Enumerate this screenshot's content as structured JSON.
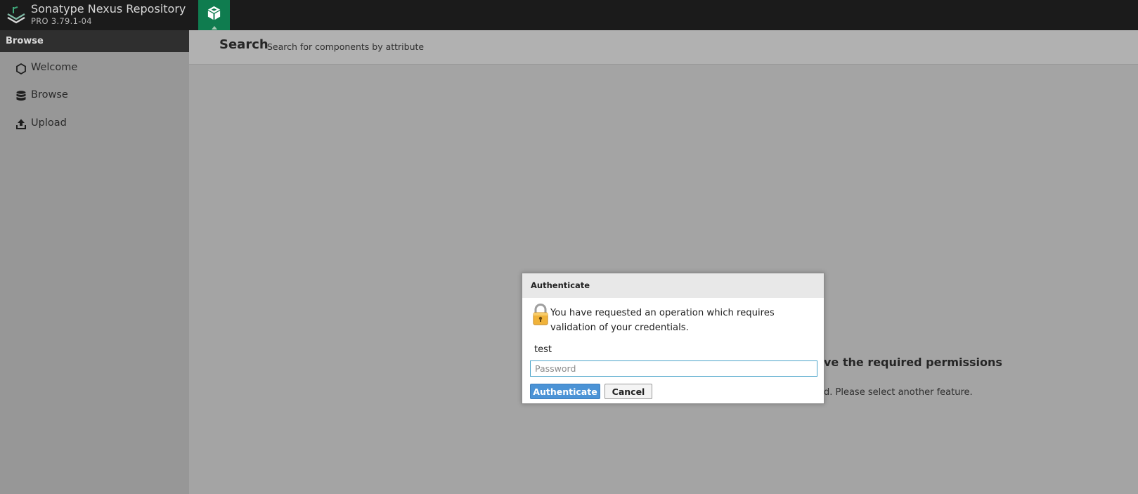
{
  "header": {
    "brand_title": "Sonatype Nexus Repository",
    "brand_version": "PRO 3.79.1-04",
    "mode_icon": "cube-icon",
    "accent_color": "#0f7c4f"
  },
  "sidebar": {
    "header": "Browse",
    "items": [
      {
        "label": "Welcome",
        "icon": "hexagon-icon"
      },
      {
        "label": "Browse",
        "icon": "database-icon"
      },
      {
        "label": "Upload",
        "icon": "upload-icon"
      }
    ]
  },
  "main": {
    "title": "Search",
    "subtitle": "Search for components by attribute",
    "permission_title": "ve the required permissions",
    "permission_body": "d. Please select another feature."
  },
  "modal": {
    "title": "Authenticate",
    "message": "You have requested an operation which requires validation of your credentials.",
    "username": "test",
    "password_placeholder": "Password",
    "password_value": "",
    "authenticate_label": "Authenticate",
    "cancel_label": "Cancel",
    "button_color": "#4b93d6"
  }
}
